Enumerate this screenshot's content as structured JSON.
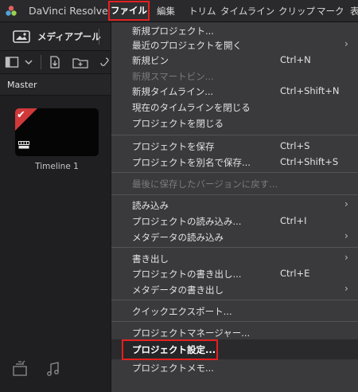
{
  "app": {
    "name": "DaVinci Resolve",
    "logo_icon": "davinci-logo-icon"
  },
  "menubar": {
    "items": [
      {
        "label": "ファイル",
        "active": true
      },
      {
        "label": "編集"
      },
      {
        "label": "トリム"
      },
      {
        "label": "タイムライン"
      },
      {
        "label": "クリップ"
      },
      {
        "label": "マーク"
      },
      {
        "label": "表"
      }
    ]
  },
  "mediapool": {
    "label": "メディアプール",
    "icon": "media-pool-icon",
    "toolbar_icons": [
      "sidebar-toggle-icon",
      "chevron-down-icon",
      "import-media-icon",
      "new-bin-icon",
      "link-icon"
    ],
    "bin_name": "Master",
    "clip": {
      "label": "Timeline 1",
      "icon": "timeline-icon"
    },
    "bottom_icons": [
      "bin-stack-icon",
      "audio-clip-icon"
    ]
  },
  "file_menu": {
    "items": [
      {
        "label": "新規プロジェクト...",
        "shortcut": "",
        "submenu": false,
        "disabled": false
      },
      {
        "label": "最近のプロジェクトを開く",
        "shortcut": "",
        "submenu": true,
        "disabled": false
      },
      {
        "label": "新規ビン",
        "shortcut": "Ctrl+N",
        "submenu": false,
        "disabled": false
      },
      {
        "label": "新規スマートビン...",
        "shortcut": "",
        "submenu": false,
        "disabled": true
      },
      {
        "label": "新規タイムライン...",
        "shortcut": "Ctrl+Shift+N",
        "submenu": false,
        "disabled": false
      },
      {
        "label": "現在のタイムラインを閉じる",
        "shortcut": "",
        "submenu": false,
        "disabled": false
      },
      {
        "label": "プロジェクトを閉じる",
        "shortcut": "",
        "submenu": false,
        "disabled": false
      },
      {
        "label": "プロジェクトを保存",
        "shortcut": "Ctrl+S",
        "submenu": false,
        "disabled": false
      },
      {
        "label": "プロジェクトを別名で保存...",
        "shortcut": "Ctrl+Shift+S",
        "submenu": false,
        "disabled": false
      },
      {
        "label": "最後に保存したバージョンに戻す...",
        "shortcut": "",
        "submenu": false,
        "disabled": true
      },
      {
        "label": "読み込み",
        "shortcut": "",
        "submenu": true,
        "disabled": false
      },
      {
        "label": "プロジェクトの読み込み...",
        "shortcut": "Ctrl+I",
        "submenu": false,
        "disabled": false
      },
      {
        "label": "メタデータの読み込み",
        "shortcut": "",
        "submenu": true,
        "disabled": false
      },
      {
        "label": "書き出し",
        "shortcut": "",
        "submenu": true,
        "disabled": false
      },
      {
        "label": "プロジェクトの書き出し...",
        "shortcut": "Ctrl+E",
        "submenu": false,
        "disabled": false
      },
      {
        "label": "メタデータの書き出し",
        "shortcut": "",
        "submenu": true,
        "disabled": false
      },
      {
        "label": "クイックエクスポート...",
        "shortcut": "",
        "submenu": false,
        "disabled": false
      },
      {
        "label": "プロジェクトマネージャー...",
        "shortcut": "",
        "submenu": false,
        "disabled": false
      },
      {
        "label": "プロジェクト設定...",
        "shortcut": "",
        "submenu": false,
        "disabled": false,
        "highlighted": true
      },
      {
        "label": "プロジェクトメモ...",
        "shortcut": "",
        "submenu": false,
        "disabled": false
      }
    ],
    "submenu_arrow": "›"
  },
  "colors": {
    "highlight_outline": "#e3201f",
    "menu_bg": "#3a3a3c",
    "panel_bg": "#1f1f21"
  }
}
